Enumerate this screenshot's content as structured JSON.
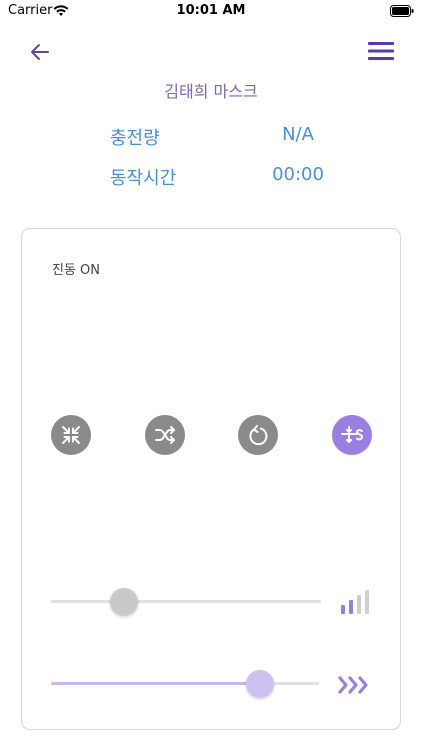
{
  "status_bar": {
    "carrier": "Carrier",
    "time": "10:01 AM"
  },
  "nav": {
    "back_icon": "arrow-left-icon",
    "menu_icon": "hamburger-menu-icon"
  },
  "device": {
    "title": "김태희 마스크"
  },
  "info": {
    "battery_label": "충전량",
    "battery_value": "N/A",
    "runtime_label": "동작시간",
    "runtime_value": "00:00"
  },
  "control": {
    "vibration_status": "진동 ON",
    "modes": [
      {
        "name": "compress",
        "icon": "arrows-inward-icon",
        "active": false
      },
      {
        "name": "shuffle",
        "icon": "shuffle-icon",
        "active": false
      },
      {
        "name": "repeat",
        "icon": "rotate-icon",
        "active": false
      },
      {
        "name": "spread",
        "icon": "spread-arrows-icon",
        "active": true
      }
    ],
    "intensity_slider": {
      "value_fraction": 0.27,
      "icon": "signal-bars-icon"
    },
    "speed_slider": {
      "value_fraction": 0.78,
      "icon": "triple-chevron-right-icon"
    }
  },
  "colors": {
    "accent_purple": "#9b7fe0",
    "title_purple": "#7a6bb0",
    "info_blue": "#4a90d9",
    "inactive_gray": "#8a8a8a"
  }
}
